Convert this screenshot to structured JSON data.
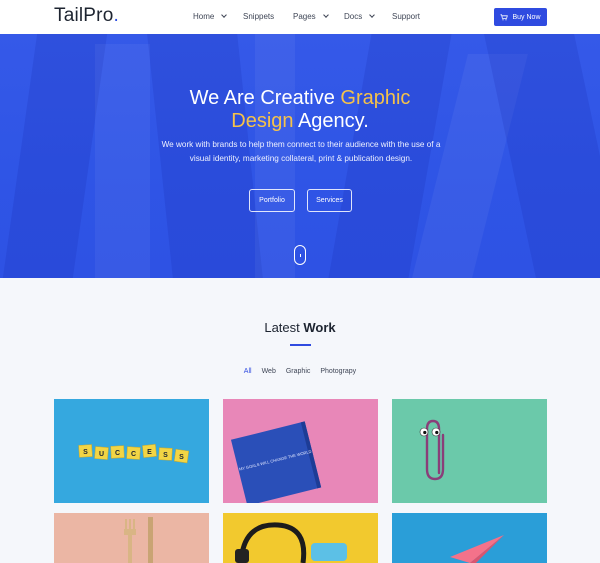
{
  "navbar": {
    "logo_main": "TailPro",
    "logo_dot": ".",
    "items": [
      {
        "label": "Home",
        "dropdown": true
      },
      {
        "label": "Snippets",
        "dropdown": false
      },
      {
        "label": "Pages",
        "dropdown": true
      },
      {
        "label": "Docs",
        "dropdown": true
      },
      {
        "label": "Support",
        "dropdown": false
      }
    ],
    "buy_label": "Buy Now"
  },
  "hero": {
    "title_part1": "We Are Creative ",
    "title_highlight1": "Graphic",
    "title_highlight2": "Design",
    "title_part2": " Agency.",
    "subtitle": "We work with brands to help them connect to their audience with the use of a visual identity, marketing collateral, print & publication design.",
    "btn_portfolio": "Portfolio",
    "btn_services": "Services"
  },
  "work": {
    "title_light": "Latest ",
    "title_bold": "Work",
    "filters": [
      "All",
      "Web",
      "Graphic",
      "Photograpy"
    ],
    "active_filter": "All",
    "success_letters": [
      "S",
      "U",
      "C",
      "C",
      "E",
      "S",
      "S"
    ],
    "notebook_text": "MY GOALS WILL CHANGE THE WORLD"
  },
  "colors": {
    "accent": "#2f4be0",
    "hero_blue": "#2f55e6",
    "highlight_yellow": "#f5c24a"
  }
}
